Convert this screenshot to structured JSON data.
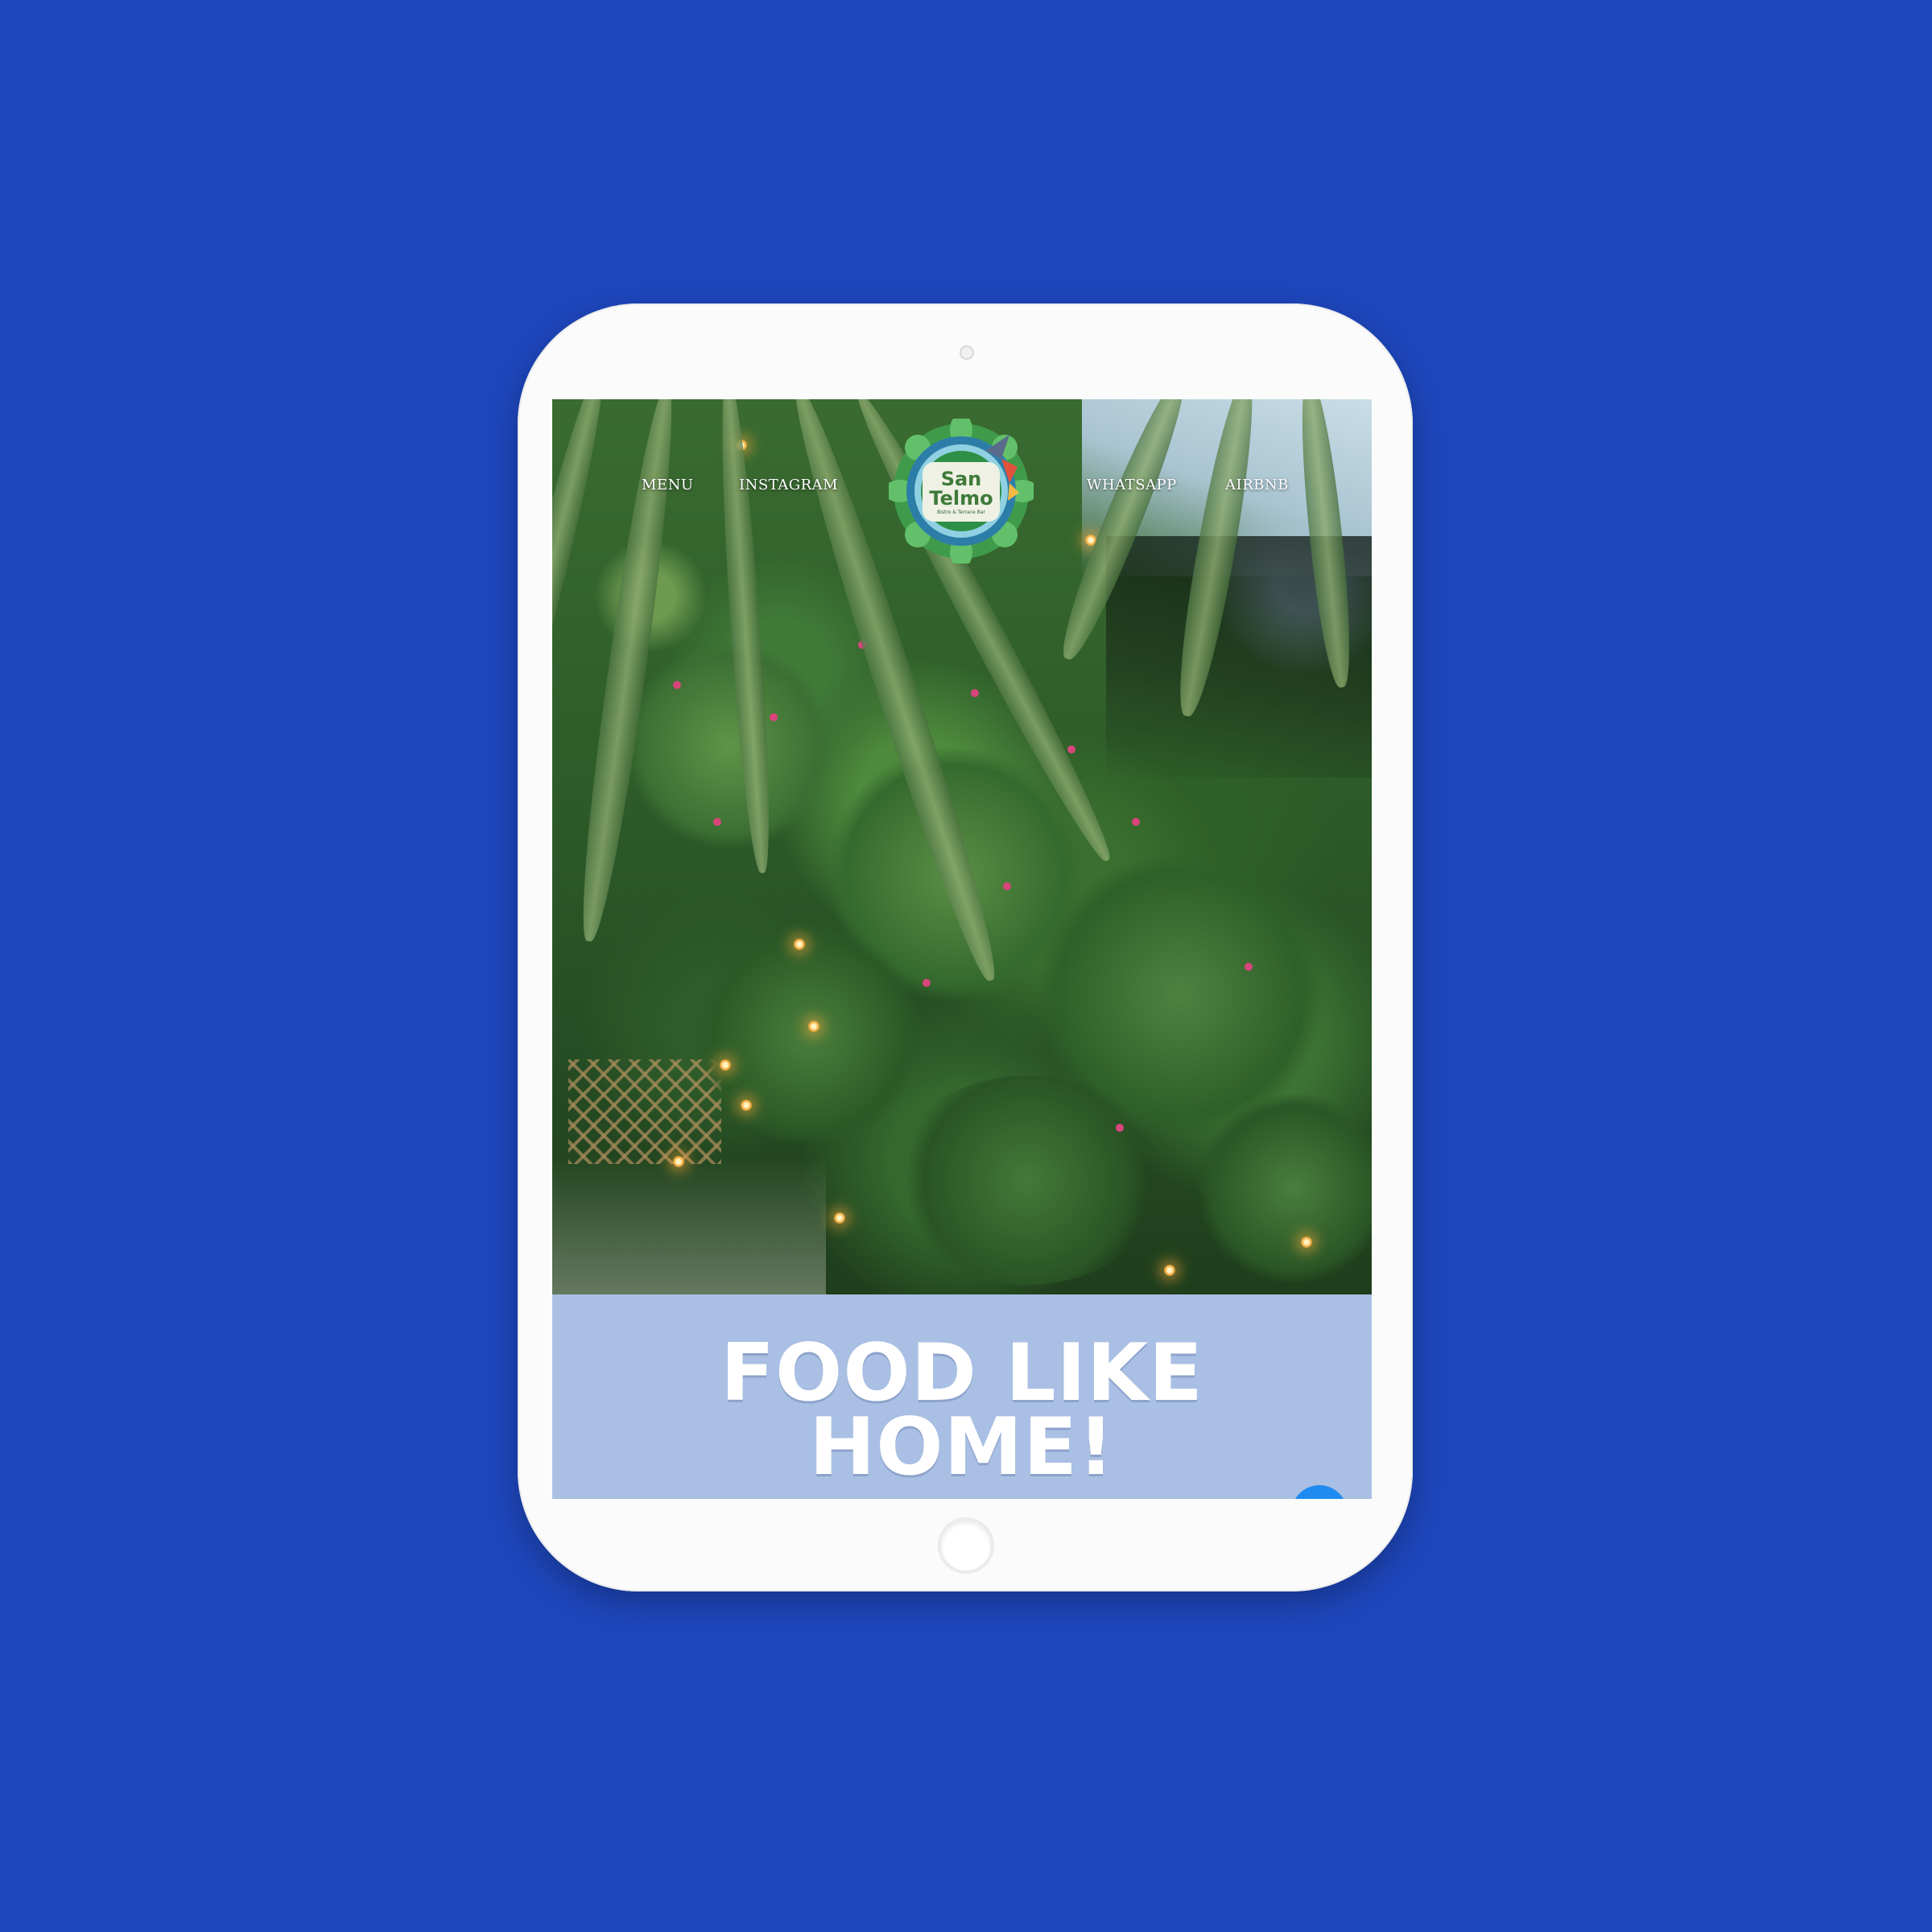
{
  "nav": {
    "menu": "MENU",
    "instagram": "INSTAGRAM",
    "whatsapp": "WHATSAPP",
    "airbnb": "AIRBNB"
  },
  "logo": {
    "line1": "San",
    "line2": "Telmo",
    "line3": "Bistro & Terrace Bar"
  },
  "hero": {
    "headline_line1": "FOOD LIKE",
    "headline_line2": "HOME!"
  },
  "colors": {
    "page_background": "#1e47bd",
    "banner_background": "#a9bfe3",
    "headline_text": "#ffffff",
    "chat_button": "#1f8bf0"
  },
  "icons": {
    "chat": "chat-bubble-icon",
    "logo": "hummingbird-mandala-logo"
  }
}
